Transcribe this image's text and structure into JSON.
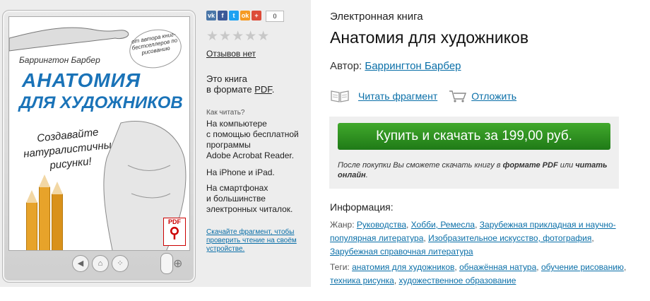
{
  "social": {
    "vk": "vk",
    "fb": "f",
    "tw": "t",
    "ok": "ok",
    "plus": "+",
    "count": "0"
  },
  "cover": {
    "author": "Баррингтон Барбер",
    "stamp": "от автора книг-бестселлеров по рисованию",
    "title_line1": "АНАТОМИЯ",
    "title_line2": "ДЛЯ ХУДОЖНИКОВ",
    "subtitle": "Создавайте натуралистичные рисунки!",
    "pdf_badge": "PDF"
  },
  "rating": {
    "stars": "★★★★★",
    "reviews": "Отзывов нет"
  },
  "format": {
    "line1": "Это книга",
    "line2_prefix": "в формате ",
    "format": "PDF",
    "line2_suffix": "."
  },
  "howto": {
    "heading": "Как читать?",
    "items": [
      [
        "На компьютере",
        "с помощью бесплатной",
        "программы",
        "Adobe Acrobat Reader."
      ],
      [
        "На iPhone и iPad."
      ],
      [
        "На смартфонах",
        "и большинстве",
        "электронных читалок."
      ]
    ]
  },
  "download_link": "Скачайте фрагмент, чтобы проверить чтение на своём устройстве.",
  "ebook_label": "Электронная книга",
  "title": "Анатомия для художников",
  "author": {
    "label": "Автор:",
    "name": "Баррингтон Барбер"
  },
  "actions": {
    "read_fragment": "Читать фрагмент",
    "postpone": "Отложить"
  },
  "buy": {
    "button": "Купить и скачать за 199,00 руб.",
    "note_prefix": "После покупки Вы сможете скачать книгу в ",
    "note_format": "формате PDF",
    "note_mid": " или ",
    "note_online": "читать онлайн",
    "note_suffix": "."
  },
  "info": {
    "heading": "Информация:",
    "genre_label": "Жанр:",
    "genres": [
      "Руководства",
      "Хобби, Ремесла",
      "Зарубежная прикладная и научно-популярная литература",
      "Изобразительное искусство, фотография",
      "Зарубежная справочная литература"
    ],
    "tags_label": "Теги:",
    "tags": [
      "анатомия для художников",
      "обнажённая натура",
      "обучение рисованию",
      "техника рисунка",
      "художественное образование"
    ]
  },
  "colors": {
    "buy_button": "#2a8f1f",
    "link": "#0a6fa8",
    "panel": "#ededed"
  }
}
